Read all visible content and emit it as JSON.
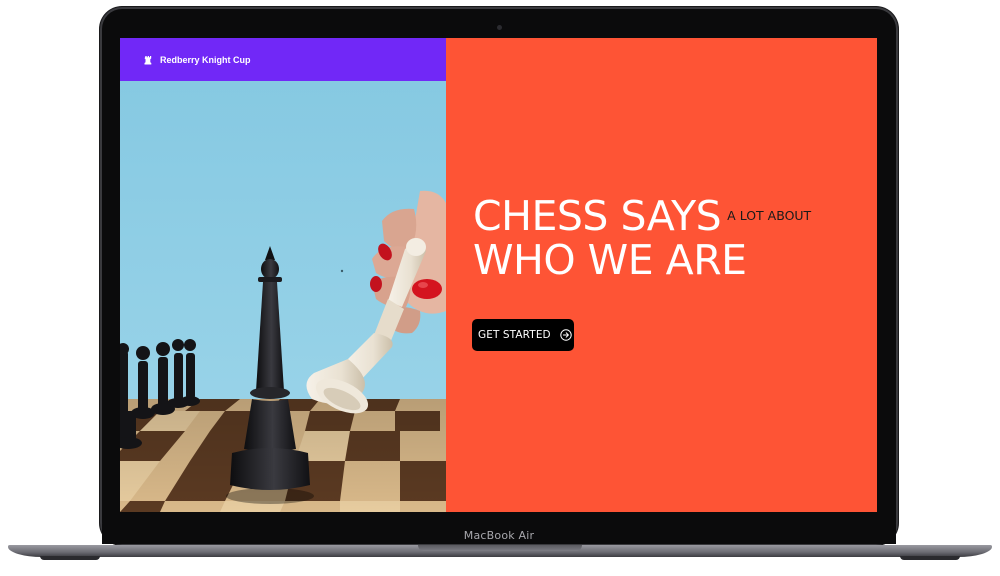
{
  "device": {
    "chin_label": "MacBook Air"
  },
  "site": {
    "brand": {
      "name": "Redberry Knight Cup",
      "icon": "chess-rook-icon"
    },
    "hero": {
      "title_line1": "CHESS SAYS",
      "title_aside": "A LOT ABOUT",
      "title_line2": "WHO WE ARE",
      "cta_label": "GET STARTED",
      "cta_icon": "arrow-circle-right-icon"
    },
    "colors": {
      "navbar": "#7128f7",
      "hero_background": "#fe5435",
      "cta_background": "#000000",
      "headline_text": "#ffffff"
    }
  }
}
